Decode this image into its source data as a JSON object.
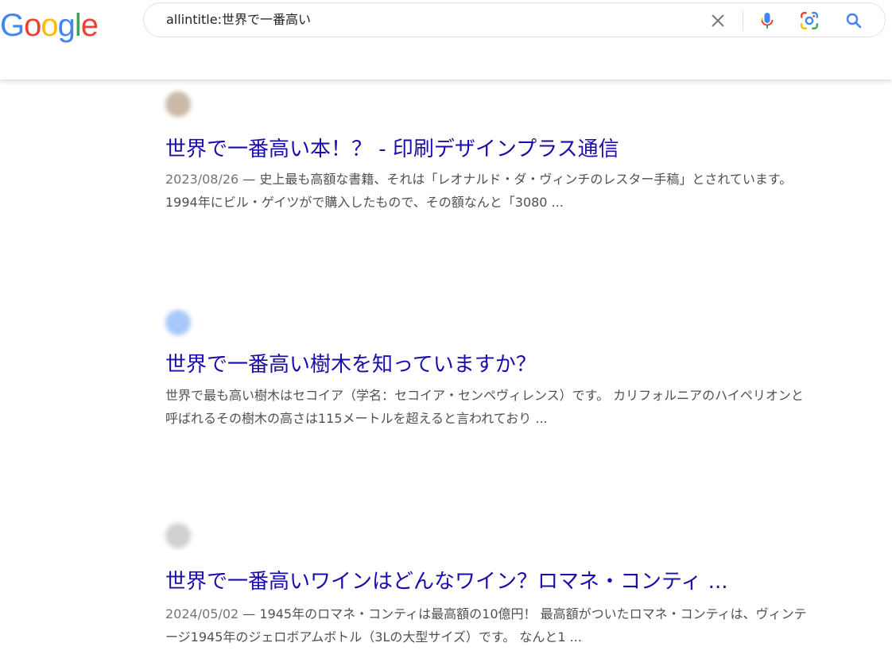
{
  "logo": {
    "letters": [
      "G",
      "o",
      "o",
      "g",
      "l",
      "e"
    ],
    "colors": [
      "#4285F4",
      "#EA4335",
      "#FBBC05",
      "#4285F4",
      "#34A853",
      "#EA4335"
    ]
  },
  "search": {
    "query": "allintitle:世界で一番高い",
    "icons": {
      "clear": "close-icon",
      "voice": "microphone-icon",
      "lens": "google-lens-icon",
      "search": "search-icon"
    }
  },
  "colors": {
    "title_link": "#1a0dab",
    "snippet": "#4d5156",
    "accent_blue": "#4285F4"
  },
  "results": [
    {
      "site_name": "",
      "site_url": "",
      "title": "世界で一番高い本！？ - 印刷デザインプラス通信",
      "date": "2023/08/26",
      "snippet": "史上最も高額な書籍、それは「レオナルド・ダ・ヴィンチのレスター手稿」とされています。 1994年にビル・ゲイツがで購入したもので、その額なんと「3080 ..."
    },
    {
      "site_name": "",
      "site_url": "",
      "title": "世界で一番高い樹木を知っていますか？",
      "date": "",
      "snippet": "世界で最も高い樹木はセコイア（学名：セコイア・センペヴィレンス）です。 カリフォルニアのハイペリオンと呼ばれるその樹木の高さは115メートルを超えると言われており ..."
    },
    {
      "site_name": "",
      "site_url": "",
      "title": "世界で一番高いワインはどんなワイン？ロマネ・コンティ ...",
      "date": "2024/05/02",
      "snippet": "1945年のロマネ・コンティは最高額の10億円！ 最高額がついたロマネ・コンティは、ヴィンテージ1945年のジェロボアムボトル（3Lの大型サイズ）です。 なんと1 ..."
    }
  ]
}
